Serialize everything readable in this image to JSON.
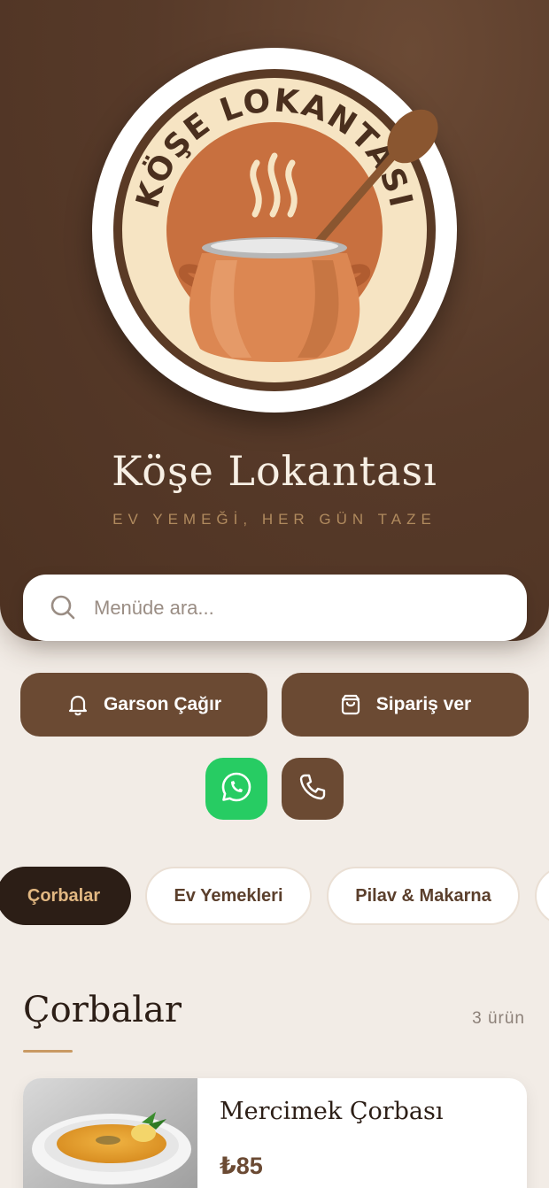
{
  "restaurant": {
    "logo_text": "KÖŞE LOKANTASI",
    "name": "Köşe Lokantası",
    "tagline": "EV YEMEĞİ, HER GÜN TAZE"
  },
  "search": {
    "placeholder": "Menüde ara..."
  },
  "actions": {
    "call_waiter": "Garson Çağır",
    "order": "Sipariş ver"
  },
  "contact": {
    "whatsapp_icon": "whatsapp-icon",
    "phone_icon": "phone-icon"
  },
  "categories": [
    {
      "label": "Çorbalar",
      "active": true
    },
    {
      "label": "Ev Yemekleri",
      "active": false
    },
    {
      "label": "Pilav & Makarna",
      "active": false
    }
  ],
  "section": {
    "title": "Çorbalar",
    "count": "3 ürün"
  },
  "products": [
    {
      "name": "Mercimek Çorbası",
      "price": "₺85"
    }
  ],
  "colors": {
    "brand_brown": "#6b4a33",
    "dark": "#2c1e16",
    "accent_gold": "#c99a63",
    "whatsapp_green": "#27cc63",
    "background": "#f2ece6"
  }
}
